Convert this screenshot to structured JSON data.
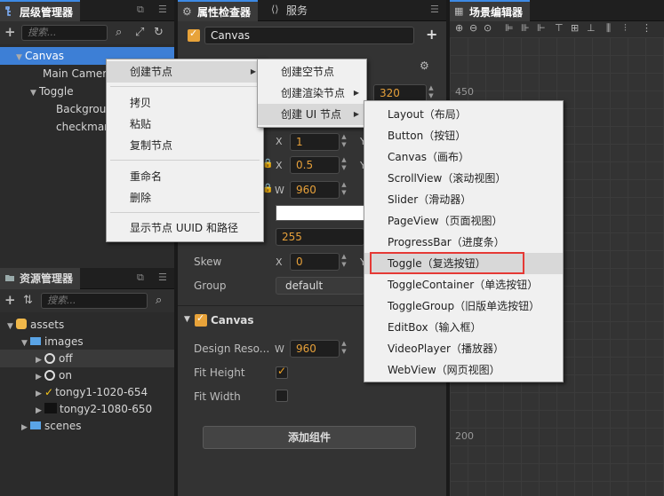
{
  "hierarchy": {
    "tab_label": "层级管理器",
    "search_placeholder": "搜索...",
    "nodes": [
      {
        "label": "Canvas",
        "selected": true
      },
      {
        "label": "Main Camera"
      },
      {
        "label": "Toggle"
      },
      {
        "label": "Background"
      },
      {
        "label": "checkmark"
      }
    ]
  },
  "assets": {
    "tab_label": "资源管理器",
    "search_placeholder": "搜索...",
    "items": [
      {
        "label": "assets"
      },
      {
        "label": "images"
      },
      {
        "label": "off"
      },
      {
        "label": "on"
      },
      {
        "label": "tongy1-1020-654"
      },
      {
        "label": "tongy2-1080-650"
      },
      {
        "label": "scenes"
      }
    ]
  },
  "inspector": {
    "tab_label": "属性检查器",
    "tab2_label": "服务",
    "node_name": "Canvas",
    "value_320": "320",
    "scale_x": "1",
    "anchor_x": "0.5",
    "size_w": "960",
    "value_255": "255",
    "skew_label": "Skew",
    "skew_x": "0",
    "group_label": "Group",
    "group_value": "default",
    "canvas_section": "Canvas",
    "design_label": "Design Reso...",
    "design_w": "960",
    "fit_height_label": "Fit Height",
    "fit_width_label": "Fit Width",
    "add_component": "添加组件",
    "axis_x": "X",
    "axis_y": "Y",
    "axis_w": "W"
  },
  "scene": {
    "tab_label": "场景编辑器",
    "ruler_450": "450",
    "ruler_200": "200"
  },
  "context_menu": {
    "items": [
      "创建节点",
      "拷贝",
      "粘贴",
      "复制节点",
      "重命名",
      "删除",
      "显示节点 UUID 和路径"
    ]
  },
  "submenu1": {
    "items": [
      "创建空节点",
      "创建渲染节点",
      "创建 UI 节点"
    ]
  },
  "submenu2": {
    "items": [
      "Layout（布局）",
      "Button（按钮）",
      "Canvas（画布）",
      "ScrollView（滚动视图）",
      "Slider（滑动器）",
      "PageView（页面视图）",
      "ProgressBar（进度条）",
      "Toggle（复选按钮）",
      "ToggleContainer（单选按钮）",
      "ToggleGroup（旧版单选按钮）",
      "EditBox（输入框）",
      "VideoPlayer（播放器）",
      "WebView（网页视图）"
    ],
    "highlighted_index": 7
  },
  "colors": {
    "accent_blue": "#3d8ae5",
    "accent_orange": "#e8a33a",
    "highlight_red": "#e53935"
  }
}
